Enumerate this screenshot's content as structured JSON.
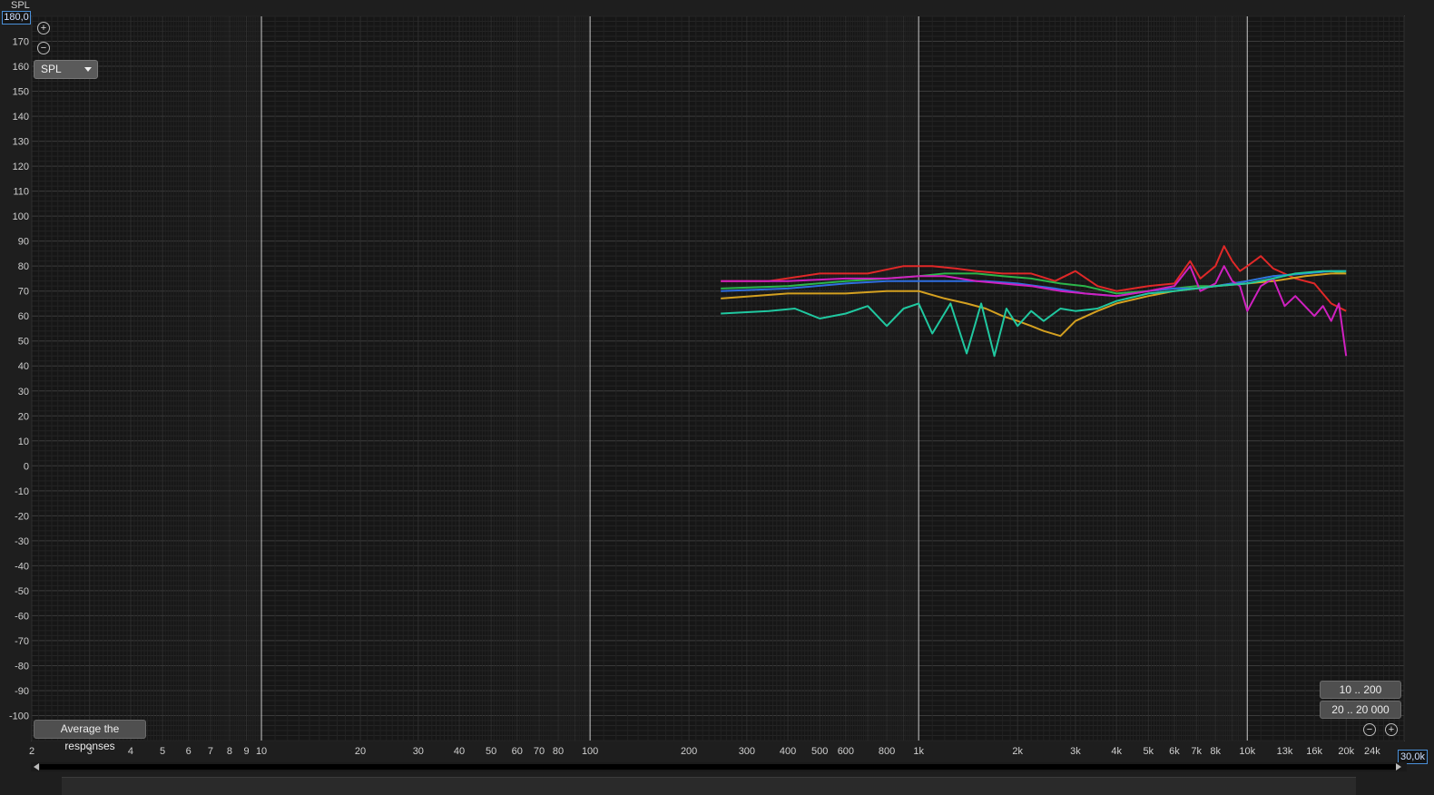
{
  "y_unit_label": "SPL",
  "y_max_box": "180,0",
  "x_max_box": "30,0k",
  "view_selector": "SPL",
  "average_button": "Average the responses",
  "range_buttons": [
    "10 .. 200",
    "20 .. 20 000"
  ],
  "chart_data": {
    "type": "line",
    "x_scale": "log",
    "xlim": [
      2,
      30000
    ],
    "ylim": [
      -110,
      180
    ],
    "ylabel": "SPL",
    "x_ticks": [
      {
        "v": 2,
        "t": "2"
      },
      {
        "v": 3,
        "t": "3"
      },
      {
        "v": 4,
        "t": "4"
      },
      {
        "v": 5,
        "t": "5"
      },
      {
        "v": 6,
        "t": "6"
      },
      {
        "v": 7,
        "t": "7"
      },
      {
        "v": 8,
        "t": "8"
      },
      {
        "v": 9,
        "t": "9"
      },
      {
        "v": 10,
        "t": "10"
      },
      {
        "v": 20,
        "t": "20"
      },
      {
        "v": 30,
        "t": "30"
      },
      {
        "v": 40,
        "t": "40"
      },
      {
        "v": 50,
        "t": "50"
      },
      {
        "v": 60,
        "t": "60"
      },
      {
        "v": 70,
        "t": "70"
      },
      {
        "v": 80,
        "t": "80"
      },
      {
        "v": 100,
        "t": "100"
      },
      {
        "v": 200,
        "t": "200"
      },
      {
        "v": 300,
        "t": "300"
      },
      {
        "v": 400,
        "t": "400"
      },
      {
        "v": 500,
        "t": "500"
      },
      {
        "v": 600,
        "t": "600"
      },
      {
        "v": 800,
        "t": "800"
      },
      {
        "v": 1000,
        "t": "1k"
      },
      {
        "v": 2000,
        "t": "2k"
      },
      {
        "v": 3000,
        "t": "3k"
      },
      {
        "v": 4000,
        "t": "4k"
      },
      {
        "v": 5000,
        "t": "5k"
      },
      {
        "v": 6000,
        "t": "6k"
      },
      {
        "v": 7000,
        "t": "7k"
      },
      {
        "v": 8000,
        "t": "8k"
      },
      {
        "v": 10000,
        "t": "10k"
      },
      {
        "v": 13000,
        "t": "13k"
      },
      {
        "v": 16000,
        "t": "16k"
      },
      {
        "v": 20000,
        "t": "20k"
      },
      {
        "v": 24000,
        "t": "24k"
      }
    ],
    "y_ticks": [
      170,
      160,
      150,
      140,
      130,
      120,
      110,
      100,
      90,
      80,
      70,
      60,
      50,
      40,
      30,
      20,
      10,
      0,
      -10,
      -20,
      -30,
      -40,
      -50,
      -60,
      -70,
      -80,
      -90,
      -100
    ],
    "grid": true,
    "series": [
      {
        "color": "#e02828",
        "points": [
          [
            250,
            74
          ],
          [
            350,
            74
          ],
          [
            500,
            77
          ],
          [
            700,
            77
          ],
          [
            900,
            80
          ],
          [
            1100,
            80
          ],
          [
            1300,
            79
          ],
          [
            1500,
            78
          ],
          [
            1800,
            77
          ],
          [
            2200,
            77
          ],
          [
            2600,
            74
          ],
          [
            3000,
            78
          ],
          [
            3500,
            72
          ],
          [
            4000,
            70
          ],
          [
            5000,
            72
          ],
          [
            6000,
            73
          ],
          [
            6700,
            82
          ],
          [
            7200,
            75
          ],
          [
            8000,
            80
          ],
          [
            8500,
            88
          ],
          [
            9000,
            82
          ],
          [
            9500,
            78
          ],
          [
            10000,
            80
          ],
          [
            11000,
            84
          ],
          [
            12000,
            79
          ],
          [
            14000,
            75
          ],
          [
            16000,
            73
          ],
          [
            18000,
            65
          ],
          [
            20000,
            62
          ]
        ]
      },
      {
        "color": "#2cb64a",
        "points": [
          [
            250,
            71
          ],
          [
            400,
            72
          ],
          [
            600,
            74
          ],
          [
            800,
            75
          ],
          [
            1000,
            76
          ],
          [
            1200,
            77
          ],
          [
            1500,
            77
          ],
          [
            1800,
            76
          ],
          [
            2200,
            75
          ],
          [
            2700,
            73
          ],
          [
            3200,
            72
          ],
          [
            4000,
            69
          ],
          [
            5000,
            70
          ],
          [
            6000,
            71
          ],
          [
            7000,
            72
          ],
          [
            8000,
            72
          ],
          [
            9000,
            73
          ],
          [
            10000,
            74
          ],
          [
            12000,
            76
          ],
          [
            15000,
            77
          ],
          [
            18000,
            78
          ],
          [
            20000,
            77
          ]
        ]
      },
      {
        "color": "#2f6fe0",
        "points": [
          [
            250,
            70
          ],
          [
            400,
            71
          ],
          [
            600,
            73
          ],
          [
            800,
            74
          ],
          [
            1000,
            74
          ],
          [
            1300,
            74
          ],
          [
            1600,
            74
          ],
          [
            2000,
            73
          ],
          [
            2600,
            71
          ],
          [
            3200,
            69
          ],
          [
            4000,
            68
          ],
          [
            5000,
            70
          ],
          [
            6000,
            71
          ],
          [
            7000,
            71
          ],
          [
            8000,
            72
          ],
          [
            10000,
            74
          ],
          [
            12000,
            76
          ],
          [
            15000,
            77
          ],
          [
            18000,
            78
          ],
          [
            20000,
            78
          ]
        ]
      },
      {
        "color": "#d4a020",
        "points": [
          [
            250,
            67
          ],
          [
            400,
            69
          ],
          [
            600,
            69
          ],
          [
            800,
            70
          ],
          [
            1000,
            70
          ],
          [
            1200,
            67
          ],
          [
            1400,
            65
          ],
          [
            1600,
            63
          ],
          [
            1800,
            60
          ],
          [
            2000,
            58
          ],
          [
            2200,
            56
          ],
          [
            2400,
            54
          ],
          [
            2700,
            52
          ],
          [
            3000,
            58
          ],
          [
            3500,
            62
          ],
          [
            4000,
            65
          ],
          [
            5000,
            68
          ],
          [
            6000,
            70
          ],
          [
            7000,
            71
          ],
          [
            8000,
            72
          ],
          [
            10000,
            73
          ],
          [
            12000,
            74
          ],
          [
            15000,
            76
          ],
          [
            18000,
            77
          ],
          [
            20000,
            77
          ]
        ]
      },
      {
        "color": "#d020c0",
        "points": [
          [
            250,
            74
          ],
          [
            400,
            74
          ],
          [
            600,
            75
          ],
          [
            800,
            75
          ],
          [
            1000,
            76
          ],
          [
            1200,
            76
          ],
          [
            1500,
            74
          ],
          [
            1800,
            73
          ],
          [
            2200,
            72
          ],
          [
            2700,
            70
          ],
          [
            3200,
            69
          ],
          [
            4000,
            68
          ],
          [
            5000,
            70
          ],
          [
            6000,
            72
          ],
          [
            6700,
            80
          ],
          [
            7200,
            70
          ],
          [
            8000,
            73
          ],
          [
            8500,
            80
          ],
          [
            9000,
            74
          ],
          [
            9500,
            72
          ],
          [
            10000,
            62
          ],
          [
            11000,
            72
          ],
          [
            12000,
            75
          ],
          [
            13000,
            64
          ],
          [
            14000,
            68
          ],
          [
            16000,
            60
          ],
          [
            17000,
            64
          ],
          [
            18000,
            58
          ],
          [
            19000,
            65
          ],
          [
            20000,
            44
          ]
        ]
      },
      {
        "color": "#20c8a0",
        "points": [
          [
            250,
            61
          ],
          [
            350,
            62
          ],
          [
            420,
            63
          ],
          [
            500,
            59
          ],
          [
            600,
            61
          ],
          [
            700,
            64
          ],
          [
            800,
            56
          ],
          [
            900,
            63
          ],
          [
            1000,
            65
          ],
          [
            1100,
            53
          ],
          [
            1250,
            65
          ],
          [
            1400,
            45
          ],
          [
            1550,
            65
          ],
          [
            1700,
            44
          ],
          [
            1850,
            63
          ],
          [
            2000,
            56
          ],
          [
            2200,
            62
          ],
          [
            2400,
            58
          ],
          [
            2700,
            63
          ],
          [
            3000,
            62
          ],
          [
            3500,
            63
          ],
          [
            4000,
            66
          ],
          [
            5000,
            69
          ],
          [
            6000,
            70
          ],
          [
            7000,
            71
          ],
          [
            8000,
            72
          ],
          [
            10000,
            73
          ],
          [
            12000,
            75
          ],
          [
            14000,
            77
          ],
          [
            17000,
            78
          ],
          [
            20000,
            78
          ]
        ]
      }
    ]
  }
}
